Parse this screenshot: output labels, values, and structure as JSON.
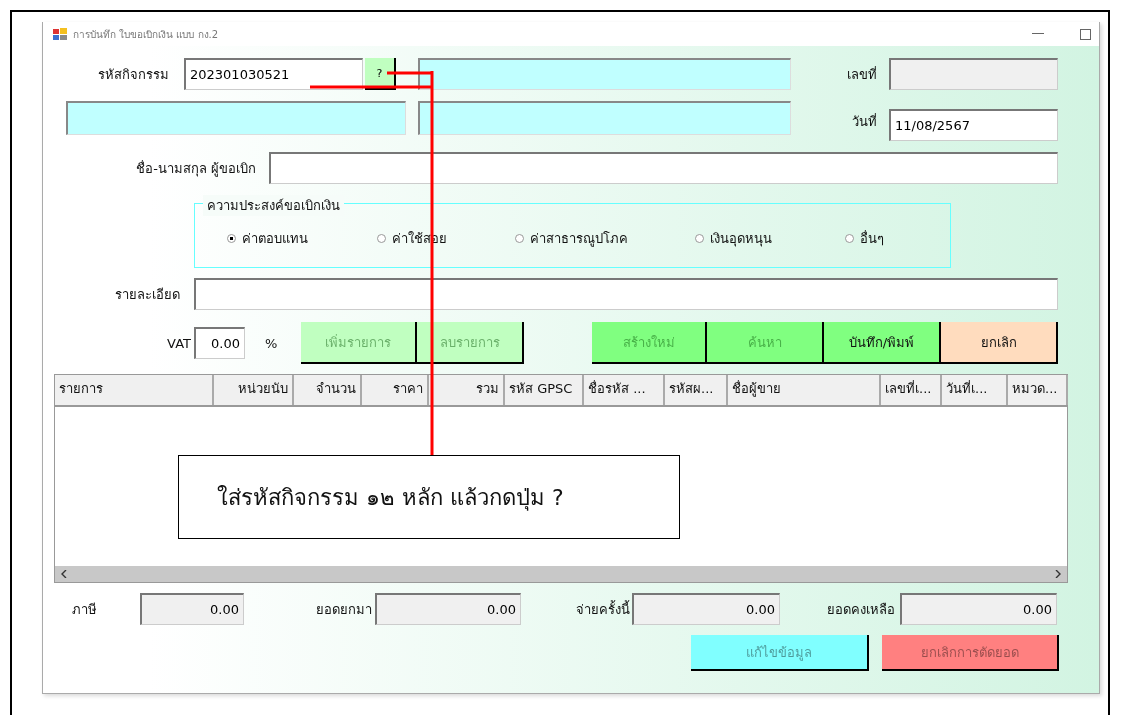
{
  "window": {
    "title": "การบันทึก ใบขอเบิกเงิน แบบ กง.2"
  },
  "activity": {
    "label": "รหัสกิจกรรม",
    "value": "202301030521",
    "lookup_button": "?"
  },
  "number": {
    "label": "เลขที่"
  },
  "date": {
    "label": "วันที่",
    "value": "11/08/2567"
  },
  "requester": {
    "label": "ชื่อ-นามสกุล ผู้ขอเบิก"
  },
  "purpose": {
    "title": "ความประสงค์ขอเบิกเงิน",
    "options": [
      {
        "label": "ค่าตอบแทน",
        "selected": true
      },
      {
        "label": "ค่าใช้สอย",
        "selected": false
      },
      {
        "label": "ค่าสาธารณูปโภค",
        "selected": false
      },
      {
        "label": "เงินอุดหนุน",
        "selected": false
      },
      {
        "label": "อื่นๆ",
        "selected": false
      }
    ]
  },
  "detail": {
    "label": "รายละเอียด"
  },
  "vat": {
    "label": "VAT",
    "value": "0.00",
    "unit": "%"
  },
  "item_buttons": [
    {
      "label": "เพิ่มรายการ",
      "color": "#c0ffc0",
      "disabled": true
    },
    {
      "label": "ลบรายการ",
      "color": "#c0ffc0",
      "disabled": true
    }
  ],
  "action_buttons": [
    {
      "label": "สร้างใหม่",
      "color": "#80ff80",
      "disabled": true
    },
    {
      "label": "ค้นหา",
      "color": "#80ff80",
      "disabled": true
    },
    {
      "label": "บันทึก/พิมพ์",
      "color": "#80ff80",
      "disabled": false
    },
    {
      "label": "ยกเลิก",
      "color": "#ffdcbe",
      "disabled": false
    }
  ],
  "table": {
    "columns": [
      "รายการ",
      "หน่วยนับ",
      "จำนวน",
      "ราคา",
      "รวม",
      "รหัส GPSC",
      "ชื่อรหัส ...",
      "รหัสผ...",
      "ชื่อผู้ขาย",
      "เลขที่เ...",
      "วันที่เ...",
      "หมวด..."
    ]
  },
  "totals": [
    {
      "label": "ภาษี",
      "value": "0.00"
    },
    {
      "label": "ยอดยกมา",
      "value": "0.00"
    },
    {
      "label": "จ่ายครั้งนี้",
      "value": "0.00"
    },
    {
      "label": "ยอดคงเหลือ",
      "value": "0.00"
    }
  ],
  "bottom_buttons": [
    {
      "label": "แก้ไขข้อมูล",
      "color": "#80ffff",
      "disabled": true
    },
    {
      "label": "ยกเลิกการตัดยอด",
      "color": "#ff8080",
      "disabled": true
    }
  ],
  "callout": {
    "text": "ใส่รหัสกิจกรรม ๑๒ หลัก แล้วกดปุ่ม ?"
  }
}
